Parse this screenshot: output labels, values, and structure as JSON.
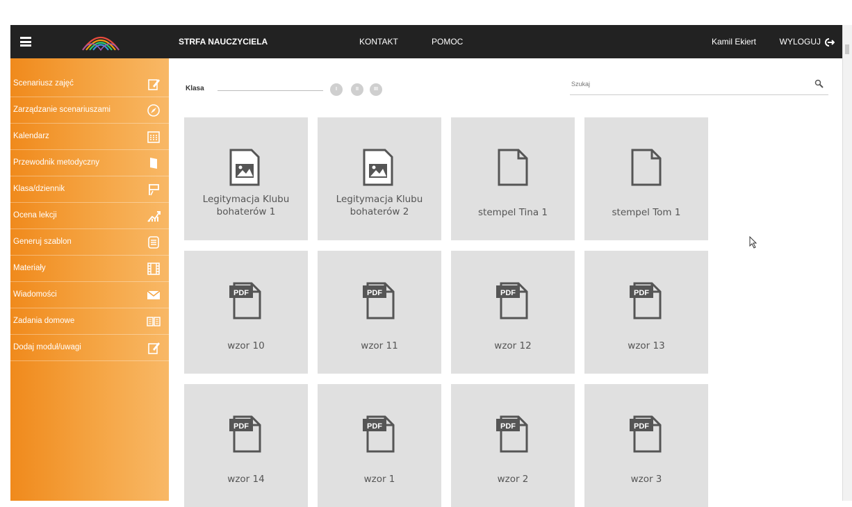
{
  "header": {
    "nav": [
      "STRFA NAUCZYCIELA",
      "KONTAKT",
      "POMOC"
    ],
    "user": "Kamil Ekiert",
    "logout": "WYLOGUJ"
  },
  "sidebar": {
    "items": [
      {
        "label": "Scenariusz zajęć",
        "icon": "edit-icon"
      },
      {
        "label": "Zarządzanie scenariuszami",
        "icon": "compass-icon"
      },
      {
        "label": "Kalendarz",
        "icon": "calendar-icon"
      },
      {
        "label": "Przewodnik metodyczny",
        "icon": "book-icon"
      },
      {
        "label": "Klasa/dziennik",
        "icon": "board-icon"
      },
      {
        "label": "Ocena lekcji",
        "icon": "chart-icon"
      },
      {
        "label": "Generuj szablon",
        "icon": "template-icon"
      },
      {
        "label": "Materiały",
        "icon": "film-icon"
      },
      {
        "label": "Wiadomości",
        "icon": "mail-icon"
      },
      {
        "label": "Zadania domowe",
        "icon": "open-book-icon"
      },
      {
        "label": "Dodaj moduł/uwagi",
        "icon": "note-icon"
      }
    ]
  },
  "filter": {
    "klasa_label": "Klasa",
    "levels": [
      "I",
      "II",
      "III"
    ],
    "search_placeholder": "Szukaj"
  },
  "files": [
    {
      "name": "Legitymacja Klubu bohaterów 1",
      "type": "image"
    },
    {
      "name": "Legitymacja Klubu bohaterów 2",
      "type": "image"
    },
    {
      "name": "stempel Tina 1",
      "type": "doc"
    },
    {
      "name": "stempel Tom 1",
      "type": "doc"
    },
    {
      "name": "wzor 10",
      "type": "pdf"
    },
    {
      "name": "wzor 11",
      "type": "pdf"
    },
    {
      "name": "wzor 12",
      "type": "pdf"
    },
    {
      "name": "wzor 13",
      "type": "pdf"
    },
    {
      "name": "wzor 14",
      "type": "pdf"
    },
    {
      "name": "wzor 1",
      "type": "pdf"
    },
    {
      "name": "wzor 2",
      "type": "pdf"
    },
    {
      "name": "wzor 3",
      "type": "pdf"
    }
  ],
  "pdf_badge": "PDF",
  "colors": {
    "topbar": "#222222",
    "sidebar_start": "#f08a1c",
    "sidebar_end": "#f8b866",
    "tile": "#e0e0e0"
  }
}
